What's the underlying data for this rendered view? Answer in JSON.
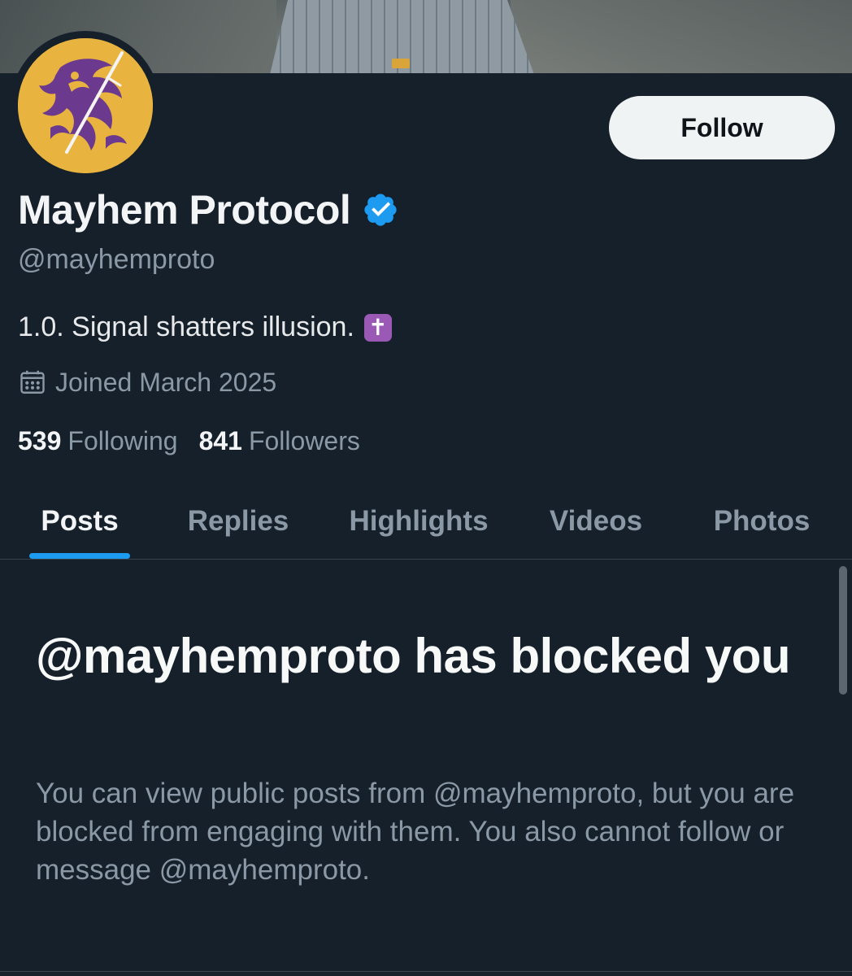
{
  "profile": {
    "display_name": "Mayhem Protocol",
    "handle": "@mayhemproto",
    "bio_text": "1.0. Signal shatters illusion.",
    "bio_emoji": "✝",
    "joined": "Joined March 2025",
    "verified": true,
    "avatar_colors": {
      "background": "#e8b33f",
      "dragon": "#6b3a8e"
    }
  },
  "actions": {
    "follow_label": "Follow"
  },
  "stats": {
    "following_count": "539",
    "following_label": "Following",
    "followers_count": "841",
    "followers_label": "Followers"
  },
  "tabs": [
    {
      "label": "Posts",
      "active": true
    },
    {
      "label": "Replies",
      "active": false
    },
    {
      "label": "Highlights",
      "active": false
    },
    {
      "label": "Videos",
      "active": false
    },
    {
      "label": "Photos",
      "active": false
    }
  ],
  "blocked": {
    "title": "@mayhemproto has blocked you",
    "body": "You can view public posts from @mayhemproto, but you are blocked from engaging with them. You also cannot follow or message @mayhemproto."
  },
  "colors": {
    "background": "#15202b",
    "accent": "#1d9bf0",
    "verified_badge": "#1d9bf0",
    "muted_text": "#8b98a5"
  },
  "icons": {
    "verified": "verified-badge-icon",
    "calendar": "calendar-icon"
  }
}
